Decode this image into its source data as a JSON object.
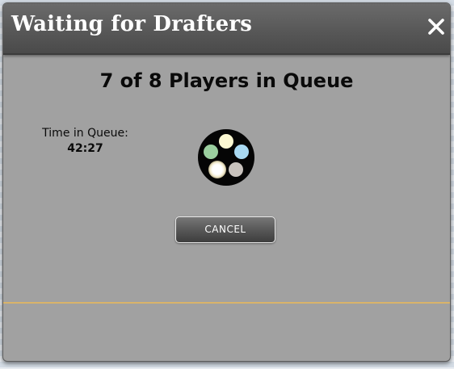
{
  "dialog": {
    "title": "Waiting for Drafters",
    "close_icon": "close-icon"
  },
  "queue": {
    "headline": "7 of 8 Players in Queue",
    "time_label": "Time in Queue:",
    "time_value": "42:27",
    "wheel_icon": "mana-wheel-icon",
    "mana_colors": {
      "white": "#fcf8d2",
      "blue": "#a9d9f2",
      "colorless": "#c8c2bd",
      "black": "#ffffff",
      "green": "#9bcf9f"
    }
  },
  "actions": {
    "cancel_label": "CANCEL"
  },
  "colors": {
    "accent_divider": "#d9b36a",
    "dialog_bg": "#a1a1a1"
  }
}
